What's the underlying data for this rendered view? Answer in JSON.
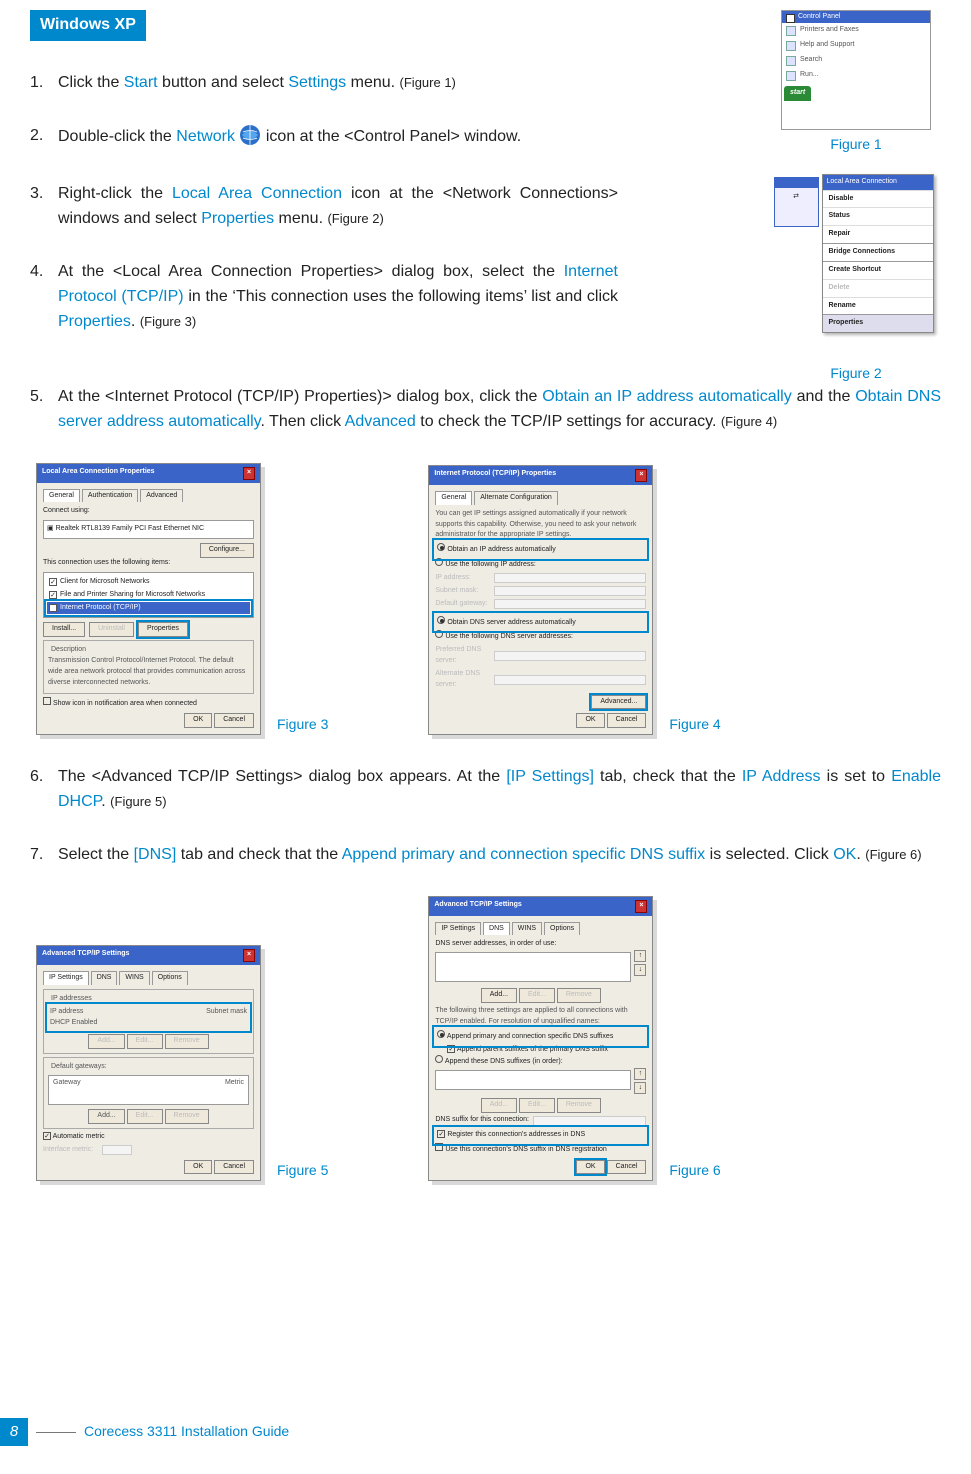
{
  "header": {
    "os": "Windows XP"
  },
  "steps": {
    "s1": {
      "num": "1.",
      "pre": "Click the ",
      "a": "Start",
      "mid": " button and select ",
      "b": "Settings",
      "post": " menu. ",
      "figref": "(Figure 1)"
    },
    "s2": {
      "num": "2.",
      "pre": "Double-click the ",
      "a": "Network",
      "post": " icon at the <Control Panel> window."
    },
    "s3": {
      "num": "3.",
      "pre": "Right-click the ",
      "a": "Local Area Connection",
      "mid": " icon at the <Network Connections> windows and select ",
      "b": "Properties",
      "post": " menu. ",
      "figref": "(Figure 2)"
    },
    "s4": {
      "num": "4.",
      "pre": "At the <Local Area Connection Properties> dialog box, select the ",
      "a": "Internet Protocol (TCP/IP)",
      "mid": " in the ‘This connection uses the following items’ list and click ",
      "b": "Properties",
      "post": ". ",
      "figref": "(Figure 3)"
    },
    "s5": {
      "num": "5.",
      "pre": "At the <Internet Protocol (TCP/IP) Properties)> dialog box, click the ",
      "a": "Obtain an IP address automatically",
      "mid": " and the ",
      "b": "Obtain DNS server address automatically",
      "mid2": ". Then click ",
      "c": "Advanced",
      "post": " to check the TCP/IP settings for accuracy. ",
      "figref": "(Figure 4)"
    },
    "s6": {
      "num": "6.",
      "pre": "The <Advanced TCP/IP Settings> dialog box appears. At the ",
      "a": "[IP Settings]",
      "mid": " tab, check that the ",
      "b": "IP Address",
      "mid2": " is set to ",
      "c": "Enable DHCP",
      "post": ". ",
      "figref": "(Figure 5)"
    },
    "s7": {
      "num": "7.",
      "pre": "Select the ",
      "a": "[DNS]",
      "mid": " tab and check that the ",
      "b": "Append primary and connection specific DNS suffix",
      "mid2": " is selected. Click ",
      "c": "OK",
      "post": ". ",
      "figref": "(Figure 6)"
    }
  },
  "captions": {
    "f1": "Figure 1",
    "f2": "Figure 2",
    "f3": "Figure 3",
    "f4": "Figure 4",
    "f5": "Figure 5",
    "f6": "Figure 6"
  },
  "fig1": {
    "title": "Control Panel",
    "items": [
      "Printers and Faxes",
      "Help and Support",
      "Search",
      "Run..."
    ],
    "start": "start"
  },
  "fig2": {
    "thumb_caption": "Local Area Connection",
    "menu_title": "Local Area Connection",
    "items": [
      "Disable",
      "Status",
      "Repair",
      "Bridge Connections",
      "Create Shortcut",
      "Delete",
      "Rename",
      "Properties"
    ]
  },
  "fig3": {
    "title": "Local Area Connection Properties",
    "tab_general": "General",
    "tab_auth": "Authentication",
    "tab_adv": "Advanced",
    "connect_using": "Connect using:",
    "adapter": "Realtek RTL8139 Family PCI Fast Ethernet NIC",
    "configure": "Configure...",
    "uses_label": "This connection uses the following items:",
    "item1": "Client for Microsoft Networks",
    "item2": "File and Printer Sharing for Microsoft Networks",
    "item3": "Internet Protocol (TCP/IP)",
    "install": "Install...",
    "uninstall": "Uninstall",
    "properties": "Properties",
    "desc_h": "Description",
    "desc": "Transmission Control Protocol/Internet Protocol. The default wide area network protocol that provides communication across diverse interconnected networks.",
    "show_icon": "Show icon in notification area when connected",
    "ok": "OK",
    "cancel": "Cancel"
  },
  "fig4": {
    "title": "Internet Protocol (TCP/IP) Properties",
    "tab_general": "General",
    "tab_alt": "Alternate Configuration",
    "blurb": "You can get IP settings assigned automatically if your network supports this capability. Otherwise, you need to ask your network administrator for the appropriate IP settings.",
    "r1": "Obtain an IP address automatically",
    "r2": "Use the following IP address:",
    "ip": "IP address:",
    "mask": "Subnet mask:",
    "gw": "Default gateway:",
    "r3": "Obtain DNS server address automatically",
    "r4": "Use the following DNS server addresses:",
    "pdns": "Preferred DNS server:",
    "adns": "Alternate DNS server:",
    "advanced": "Advanced...",
    "ok": "OK",
    "cancel": "Cancel"
  },
  "fig5": {
    "title": "Advanced TCP/IP Settings",
    "tab_ip": "IP Settings",
    "tab_dns": "DNS",
    "tab_wins": "WINS",
    "tab_opt": "Options",
    "ip_addresses": "IP addresses",
    "ip_col1": "IP address",
    "ip_col2": "Subnet mask",
    "dhcp": "DHCP Enabled",
    "add": "Add...",
    "edit": "Edit...",
    "remove": "Remove",
    "gw_h": "Default gateways:",
    "gw_col1": "Gateway",
    "gw_col2": "Metric",
    "auto_metric": "Automatic metric",
    "if_metric": "Interface metric:",
    "ok": "OK",
    "cancel": "Cancel"
  },
  "fig6": {
    "title": "Advanced TCP/IP Settings",
    "tab_ip": "IP Settings",
    "tab_dns": "DNS",
    "tab_wins": "WINS",
    "tab_opt": "Options",
    "dns_order": "DNS server addresses, in order of use:",
    "add": "Add...",
    "edit": "Edit...",
    "remove": "Remove",
    "blurb": "The following three settings are applied to all connections with TCP/IP enabled. For resolution of unqualified names:",
    "r1": "Append primary and connection specific DNS suffixes",
    "r1a": "Append parent suffixes of the primary DNS suffix",
    "r2": "Append these DNS suffixes (in order):",
    "conn_suffix": "DNS suffix for this connection:",
    "reg": "Register this connection's addresses in DNS",
    "use_suffix": "Use this connection's DNS suffix in DNS registration",
    "ok": "OK",
    "cancel": "Cancel"
  },
  "footer": {
    "page": "8",
    "guide": "Corecess 3311 Installation Guide"
  }
}
